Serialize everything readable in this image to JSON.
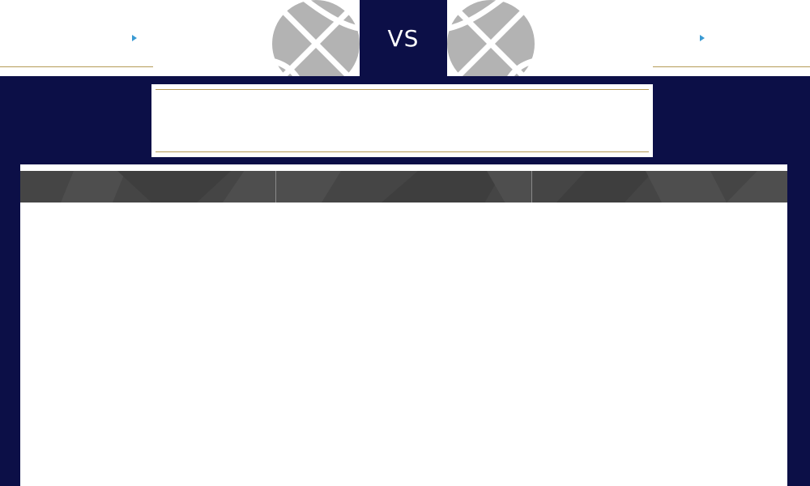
{
  "matchup": {
    "vs_label": "VS",
    "home_team": {
      "name": "",
      "logo_icon": "basketball-icon"
    },
    "away_team": {
      "name": "",
      "logo_icon": "basketball-icon"
    }
  },
  "info": {
    "text": ""
  },
  "tabs": [
    {
      "label": ""
    },
    {
      "label": ""
    },
    {
      "label": ""
    }
  ],
  "colors": {
    "navy": "#0c0f47",
    "gold_rule": "#b59b57",
    "arrow_blue": "#3a9ad3",
    "tab_gray": "#454545",
    "ball_gray": "#b3b3b3"
  }
}
